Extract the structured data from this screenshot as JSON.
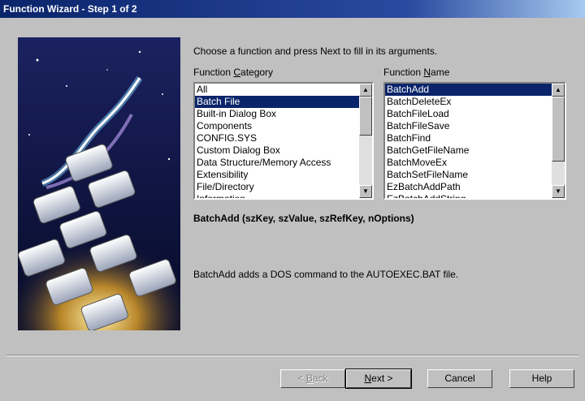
{
  "window": {
    "title": "Function Wizard - Step 1 of 2"
  },
  "instructions": "Choose a function and press Next to fill in its arguments.",
  "category": {
    "label_pre": "Function ",
    "label_key": "C",
    "label_post": "ategory",
    "items": [
      "All",
      "Batch File",
      "Built-in Dialog Box",
      "Components",
      "CONFIG.SYS",
      "Custom Dialog Box",
      "Data Structure/Memory Access",
      "Extensibility",
      "File/Directory",
      "Information"
    ],
    "selected": "Batch File"
  },
  "function": {
    "label_pre": "Function ",
    "label_key": "N",
    "label_post": "ame",
    "items": [
      "BatchAdd",
      "BatchDeleteEx",
      "BatchFileLoad",
      "BatchFileSave",
      "BatchFind",
      "BatchGetFileName",
      "BatchMoveEx",
      "BatchSetFileName",
      "EzBatchAddPath",
      "EzBatchAddString"
    ],
    "selected": "BatchAdd"
  },
  "signature": "BatchAdd (szKey, szValue, szRefKey, nOptions)",
  "description": "BatchAdd adds a DOS command to the AUTOEXEC.BAT file.",
  "art_keys": [
    "AskPath",
    "Enable",
    "Is",
    "Do",
    "Delay",
    "Disable",
    "CtrlDir",
    "UseDLL"
  ],
  "buttons": {
    "back": {
      "pre": "< ",
      "key": "B",
      "post": "ack"
    },
    "next": {
      "key": "N",
      "post": "ext >"
    },
    "cancel": "Cancel",
    "help": "Help"
  }
}
